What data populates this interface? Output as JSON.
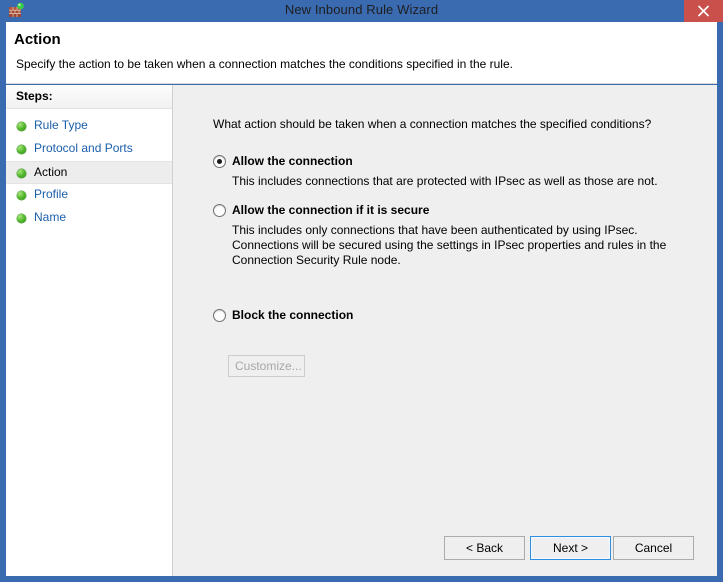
{
  "window": {
    "title": "New Inbound Rule Wizard",
    "icon": "firewall-brick-wall-icon",
    "close_label": "×",
    "title_bar_color": "#3a6ab0",
    "close_button_color": "#c9504b"
  },
  "header": {
    "title": "Action",
    "subtitle": "Specify the action to be taken when a connection matches the conditions specified in the rule."
  },
  "sidebar": {
    "heading": "Steps:",
    "items": [
      {
        "label": "Rule Type",
        "current": false
      },
      {
        "label": "Protocol and Ports",
        "current": false
      },
      {
        "label": "Action",
        "current": true
      },
      {
        "label": "Profile",
        "current": false
      },
      {
        "label": "Name",
        "current": false
      }
    ]
  },
  "main": {
    "question": "What action should be taken when a connection matches the specified conditions?",
    "options": [
      {
        "label": "Allow the connection",
        "selected": true,
        "description": "This includes connections that are protected with IPsec as well as those are not."
      },
      {
        "label": "Allow the connection if it is secure",
        "selected": false,
        "description": "This includes only connections that have been authenticated by using IPsec.  Connections will be secured using the settings in IPsec properties and rules in the Connection Security Rule node."
      },
      {
        "label": "Block the connection",
        "selected": false,
        "description": ""
      }
    ],
    "customize_button": {
      "label": "Customize...",
      "enabled": false
    }
  },
  "footer": {
    "back_label": "< Back",
    "next_label": "Next >",
    "cancel_label": "Cancel"
  }
}
